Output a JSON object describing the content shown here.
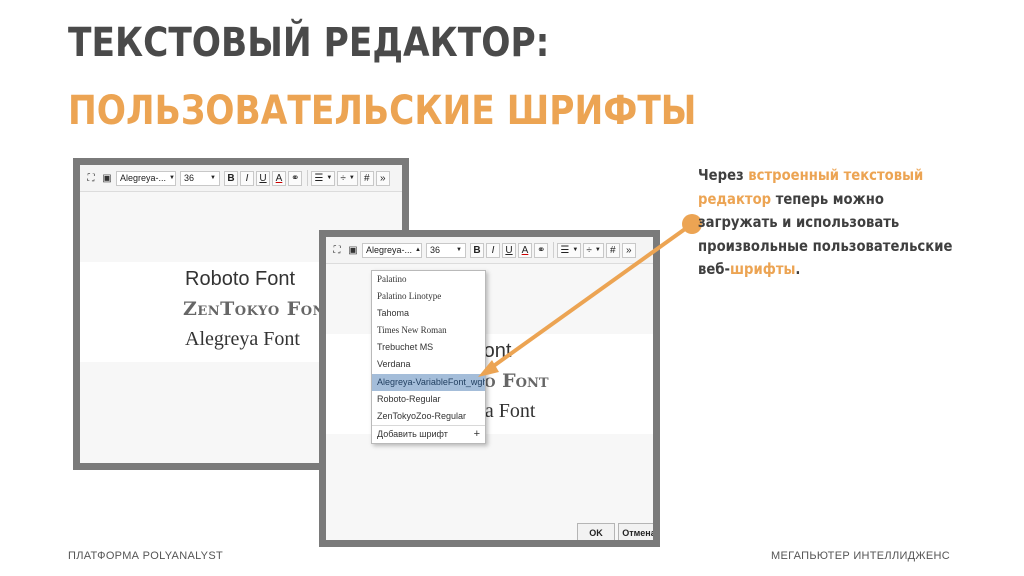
{
  "title": {
    "line1": "ТЕКСТОВЫЙ РЕДАКТОР:",
    "line2": "ПОЛЬЗОВАТЕЛЬСКИЕ ШРИФТЫ"
  },
  "toolbar": {
    "font_value": "Alegreya-...",
    "font_value_2": "Alegreya-...",
    "size_value": "36",
    "bold": "B",
    "italic": "I",
    "underline": "U",
    "font_color": "A",
    "more": "»",
    "hash": "#"
  },
  "samples": {
    "roboto": "Roboto Font",
    "zen": "ZenTokyo Font",
    "alegreya": "Alegreya Font"
  },
  "samples_partial": {
    "roboto": "oto Font",
    "zen": "kyo Font",
    "alegreya": "eya Font"
  },
  "dropdown": {
    "items": [
      "Palatino",
      "Palatino Linotype",
      "Tahoma",
      "Times New Roman",
      "Trebuchet MS",
      "Verdana",
      "Alegreya-VariableFont_wght",
      "Roboto-Regular",
      "ZenTokyoZoo-Regular"
    ],
    "selected": "Alegreya-VariableFont_wght",
    "add_label": "Добавить шрифт",
    "add_icon": "+"
  },
  "dialog_buttons": {
    "ok": "OK",
    "cancel": "Отмена"
  },
  "description": {
    "part1": "Через ",
    "hl1": "встроенный текстовый редактор",
    "part2": " теперь можно загружать и использовать произвольные пользовательские веб-",
    "hl2": "шрифты",
    "part3": "."
  },
  "footer": {
    "left": "ПЛАТФОРМА POLYANALYST",
    "right": "МЕГАПЬЮТЕР ИНТЕЛЛИДЖЕНС"
  },
  "colors": {
    "accent": "#eca453",
    "title_dark": "#4a4a4a",
    "selection": "#a4bdd9"
  }
}
